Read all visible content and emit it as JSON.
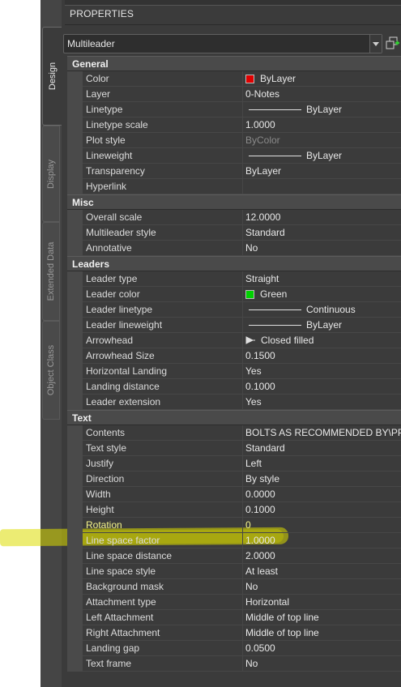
{
  "panel": {
    "title": "PROPERTIES",
    "selected_object": "Multileader",
    "tabs": [
      "Design",
      "Display",
      "Extended Data",
      "Object Class"
    ]
  },
  "categories": [
    {
      "name": "General",
      "rows": [
        {
          "name": "Color",
          "value": "ByLayer",
          "swatch": "#e00000"
        },
        {
          "name": "Layer",
          "value": "0-Notes"
        },
        {
          "name": "Linetype",
          "value": "ByLayer",
          "line": true
        },
        {
          "name": "Linetype scale",
          "value": "1.0000"
        },
        {
          "name": "Plot style",
          "value": "ByColor",
          "dim": true
        },
        {
          "name": "Lineweight",
          "value": "ByLayer",
          "line": true
        },
        {
          "name": "Transparency",
          "value": "ByLayer"
        },
        {
          "name": "Hyperlink",
          "value": ""
        }
      ]
    },
    {
      "name": "Misc",
      "rows": [
        {
          "name": "Overall scale",
          "value": "12.0000"
        },
        {
          "name": "Multileader style",
          "value": "Standard"
        },
        {
          "name": "Annotative",
          "value": "No"
        }
      ]
    },
    {
      "name": "Leaders",
      "rows": [
        {
          "name": "Leader type",
          "value": "Straight"
        },
        {
          "name": "Leader color",
          "value": "Green",
          "swatch": "#00d000"
        },
        {
          "name": "Leader linetype",
          "value": "Continuous",
          "line": true
        },
        {
          "name": "Leader lineweight",
          "value": "ByLayer",
          "line": true
        },
        {
          "name": "Arrowhead",
          "value": "Closed filled",
          "arrow": true
        },
        {
          "name": "Arrowhead Size",
          "value": "0.1500"
        },
        {
          "name": "Horizontal Landing",
          "value": "Yes"
        },
        {
          "name": "Landing distance",
          "value": "0.1000"
        },
        {
          "name": "Leader extension",
          "value": "Yes"
        }
      ]
    },
    {
      "name": "Text",
      "rows": [
        {
          "name": "Contents",
          "value": "BOLTS AS RECOMMENDED BY\\PPIP"
        },
        {
          "name": "Text style",
          "value": "Standard"
        },
        {
          "name": "Justify",
          "value": "Left"
        },
        {
          "name": "Direction",
          "value": "By style"
        },
        {
          "name": "Width",
          "value": "0.0000"
        },
        {
          "name": "Height",
          "value": "0.1000"
        },
        {
          "name": "Rotation",
          "value": "0",
          "highlight": true
        },
        {
          "name": "Line space factor",
          "value": "1.0000"
        },
        {
          "name": "Line space distance",
          "value": "2.0000"
        },
        {
          "name": "Line space style",
          "value": "At least"
        },
        {
          "name": "Background mask",
          "value": "No"
        },
        {
          "name": "Attachment type",
          "value": "Horizontal"
        },
        {
          "name": "Left Attachment",
          "value": "Middle of top line"
        },
        {
          "name": "Right Attachment",
          "value": "Middle of top line"
        },
        {
          "name": "Landing gap",
          "value": "0.0500"
        },
        {
          "name": "Text frame",
          "value": "No"
        }
      ]
    }
  ],
  "icons": {
    "quick_select": "quick-select-icon",
    "dropdown": "chevron-down-icon"
  },
  "colors": {
    "panel_bg": "#3b3b3b",
    "highlight": "#dcdc00"
  }
}
